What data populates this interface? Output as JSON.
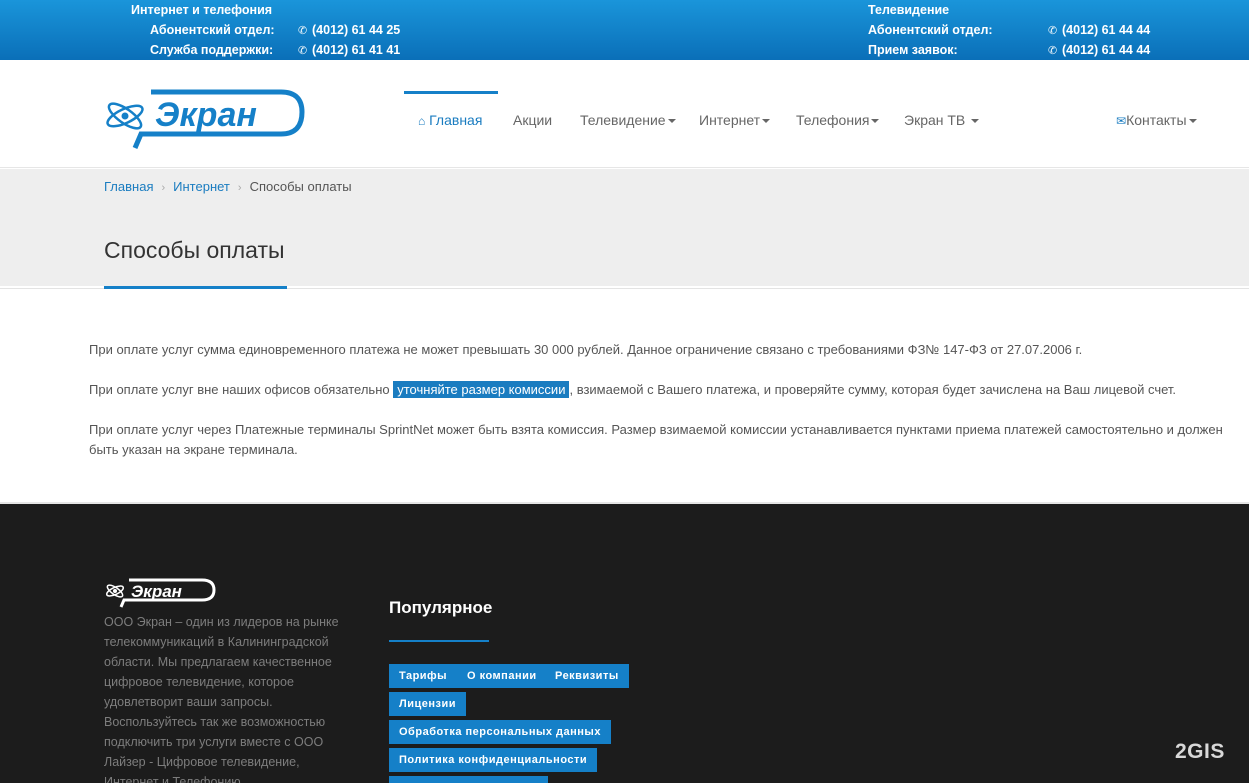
{
  "topbar": {
    "internet_title": "Интернет и телефония",
    "subscriber_label": "Абонентский отдел:",
    "subscriber_phone": "(4012) 61 44 25",
    "support_label": "Служба поддержки:",
    "support_phone": "(4012) 61 41 41",
    "tv_title": "Телевидение",
    "tv_subscriber_label": "Абонентский отдел:",
    "tv_subscriber_phone": "(4012) 61 44 44",
    "tv_orders_label": "Прием заявок:",
    "tv_orders_phone": "(4012) 61 44 44"
  },
  "logo": {
    "text": "Экран"
  },
  "nav": {
    "home": "Главная",
    "promos": "Акции",
    "tv": "Телевидение",
    "internet": "Интернет",
    "telephony": "Телефония",
    "ekran_tv": "Экран ТВ",
    "contacts": "Контакты"
  },
  "breadcrumb": {
    "home": "Главная",
    "internet": "Интернет",
    "current": "Способы оплаты"
  },
  "page": {
    "title": "Способы оплаты",
    "p1": "При оплате услуг сумма единовременного платежа не может превышать 30 000 рублей. Данное ограничение связано с требованиями ФЗ№ 147-ФЗ от 27.07.2006 г.",
    "p2_before": "При оплате услуг вне наших офисов обязательно ",
    "p2_highlight": "уточняйте размер комиссии",
    "p2_after": ", взимаемой с Вашего платежа, и проверяйте сумму, которая будет зачислена на Ваш лицевой счет.",
    "p3": "При оплате услуг через Платежные терминалы SprintNet может быть взята комиссия. Размер взимаемой комиссии устанавливается пунктами приема платежей самостоятельно и должен быть указан на экране терминала."
  },
  "footer": {
    "about": "ООО Экран – один из лидеров на рынке телекоммуникаций в Калининградской области. Мы предлагаем качественное цифровое телевидение, которое удовлетворит ваши запросы. Воспользуйтесь так же возможностью подключить три услуги вместе с ООО Лайзер - Цифровое телевидение, Интернет и Телефонию.",
    "popular_title": "Популярное",
    "tags": [
      "Тарифы",
      "О компании",
      "Реквизиты",
      "Лицензии",
      "Обработка персональных данных",
      "Политика конфиденциальности"
    ]
  },
  "watermark": "2GIS",
  "colors": {
    "brand_blue": "#1580c8",
    "topbar_blue": "#0a6fb8",
    "footer_bg": "#1c1c1c"
  }
}
